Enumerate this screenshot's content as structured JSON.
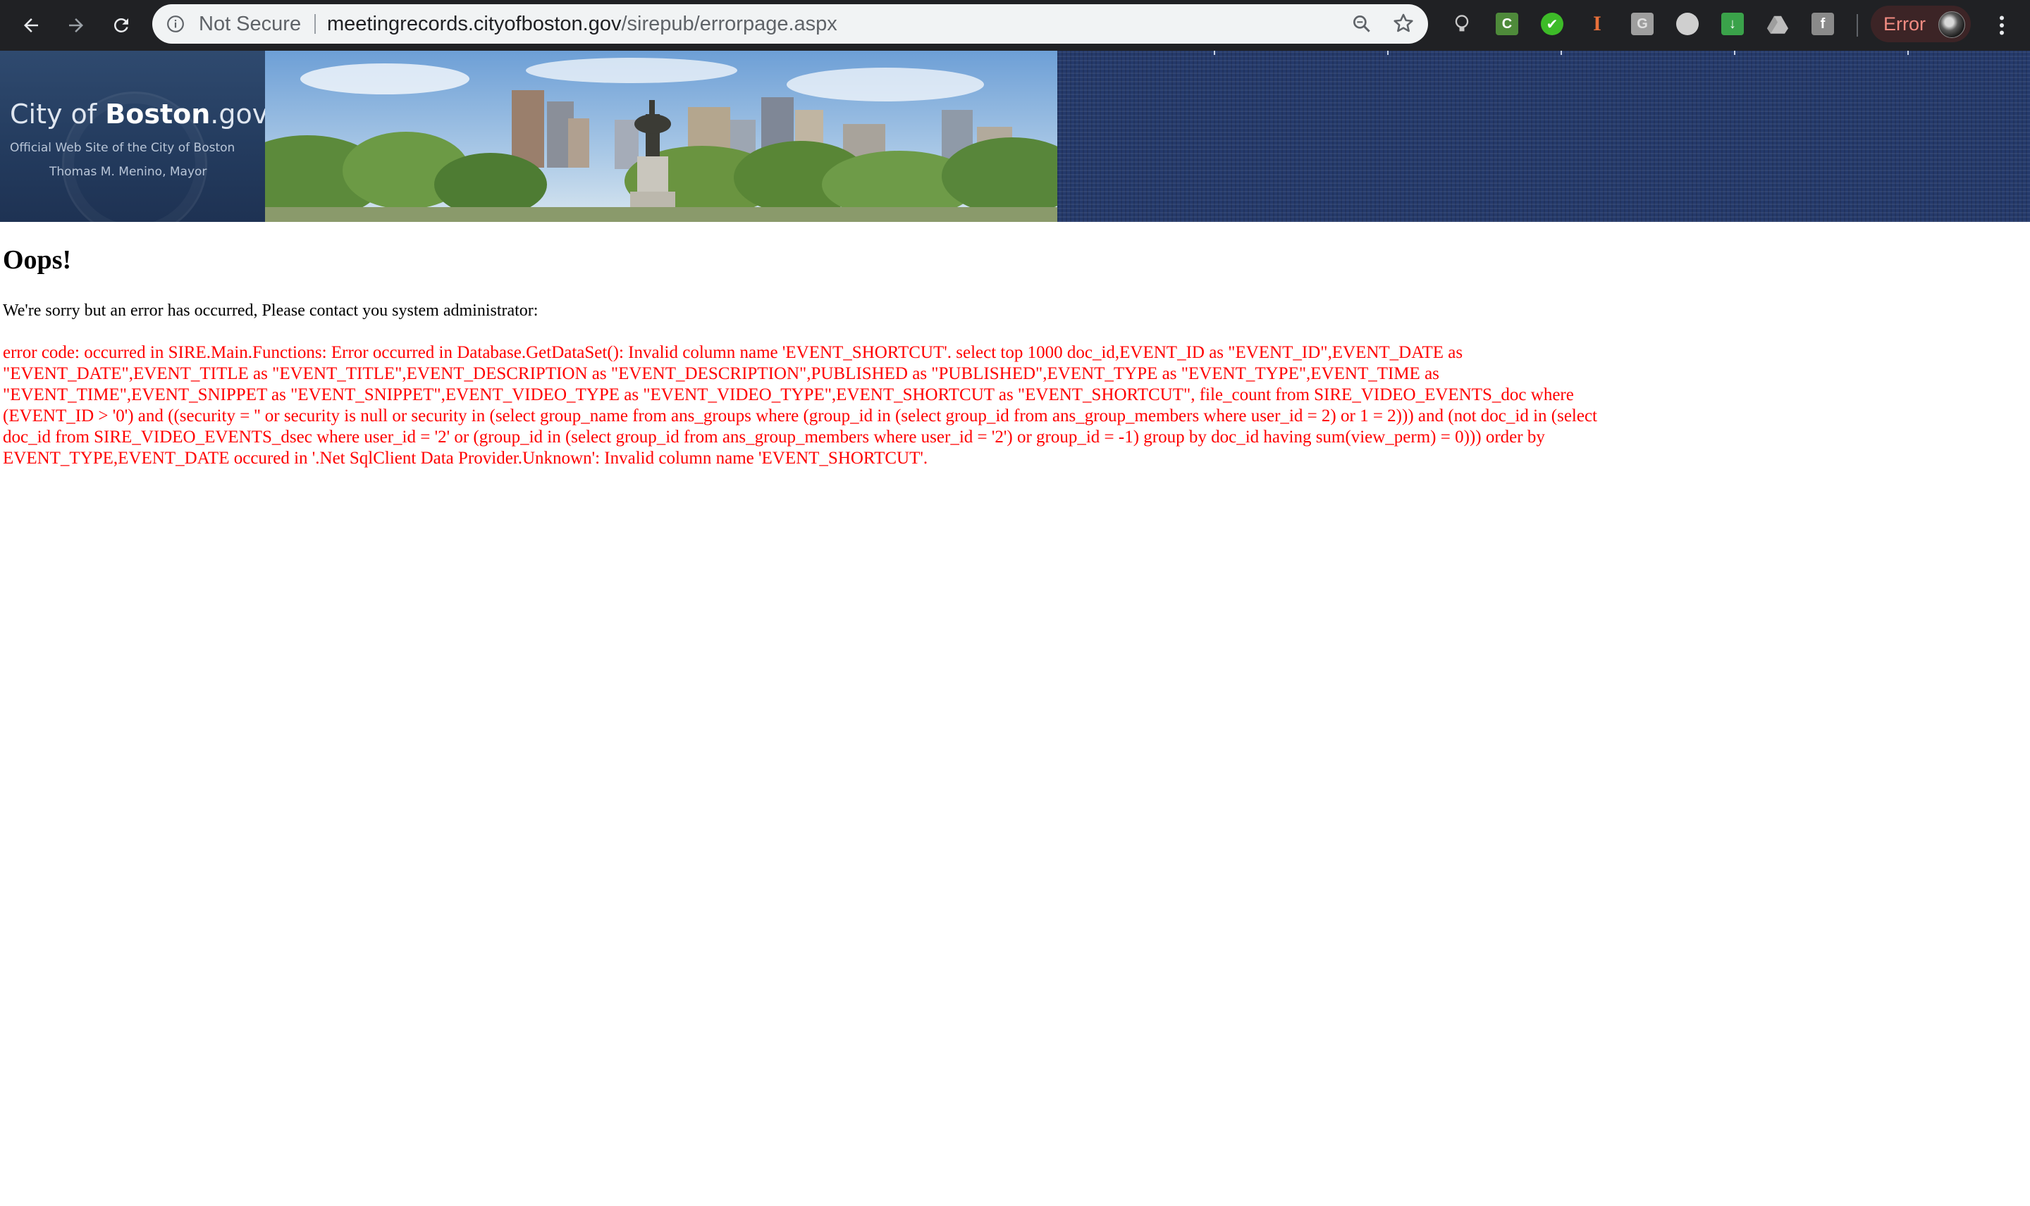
{
  "browser": {
    "security_label": "Not Secure",
    "url_host": "meetingrecords.cityofboston.gov",
    "url_path": "/sirepub/errorpage.aspx",
    "profile_status": "Error",
    "icons": {
      "back": "arrow-left-icon",
      "forward": "arrow-right-icon",
      "reload": "reload-icon",
      "info": "info-icon",
      "zoom": "zoom-icon",
      "bookmark": "star-icon",
      "menu": "kebab-menu-icon"
    },
    "extensions": [
      {
        "name": "lightbulb-extension-icon",
        "glyph": ""
      },
      {
        "name": "green-square-extension-icon",
        "glyph": "C"
      },
      {
        "name": "thumbs-up-extension-icon",
        "glyph": "✔"
      },
      {
        "name": "text-cursor-extension-icon",
        "glyph": "I"
      },
      {
        "name": "gray-square-extension-icon",
        "glyph": "G"
      },
      {
        "name": "gray-circle-extension-icon",
        "glyph": ""
      },
      {
        "name": "download-extension-icon",
        "glyph": "↓"
      },
      {
        "name": "drive-extension-icon",
        "glyph": ""
      },
      {
        "name": "facebook-extension-icon",
        "glyph": "f"
      }
    ],
    "colors": {
      "toolbar": "#202124",
      "omnibox": "#f1f3f4",
      "error_text": "#f28b82"
    }
  },
  "banner": {
    "logo_prefix": "City of ",
    "logo_name": "Boston",
    "logo_suffix": ".gov",
    "subtitle": "Official Web Site of the City of Boston",
    "mayor": "Thomas M. Menino, Mayor"
  },
  "content": {
    "heading": "Oops!",
    "message": "We're sorry but an error has occurred, Please contact you system administrator:",
    "error_text": "error code: occurred in SIRE.Main.Functions: Error occurred in Database.GetDataSet(): Invalid column name 'EVENT_SHORTCUT'. select top 1000 doc_id,EVENT_ID as \"EVENT_ID\",EVENT_DATE as \"EVENT_DATE\",EVENT_TITLE as \"EVENT_TITLE\",EVENT_DESCRIPTION as \"EVENT_DESCRIPTION\",PUBLISHED as \"PUBLISHED\",EVENT_TYPE as \"EVENT_TYPE\",EVENT_TIME as \"EVENT_TIME\",EVENT_SNIPPET as \"EVENT_SNIPPET\",EVENT_VIDEO_TYPE as \"EVENT_VIDEO_TYPE\",EVENT_SHORTCUT as \"EVENT_SHORTCUT\", file_count from SIRE_VIDEO_EVENTS_doc where (EVENT_ID > '0') and ((security = '' or security is null or security in (select group_name from ans_groups where (group_id in (select group_id from ans_group_members where user_id = 2) or 1 = 2))) and (not doc_id in (select doc_id from SIRE_VIDEO_EVENTS_dsec where user_id = '2' or (group_id in (select group_id from ans_group_members where user_id = '2') or group_id = -1) group by doc_id having sum(view_perm) = 0))) order by EVENT_TYPE,EVENT_DATE occured in '.Net SqlClient Data Provider.Unknown': Invalid column name 'EVENT_SHORTCUT'.",
    "colors": {
      "error_text": "#ff0000"
    }
  }
}
